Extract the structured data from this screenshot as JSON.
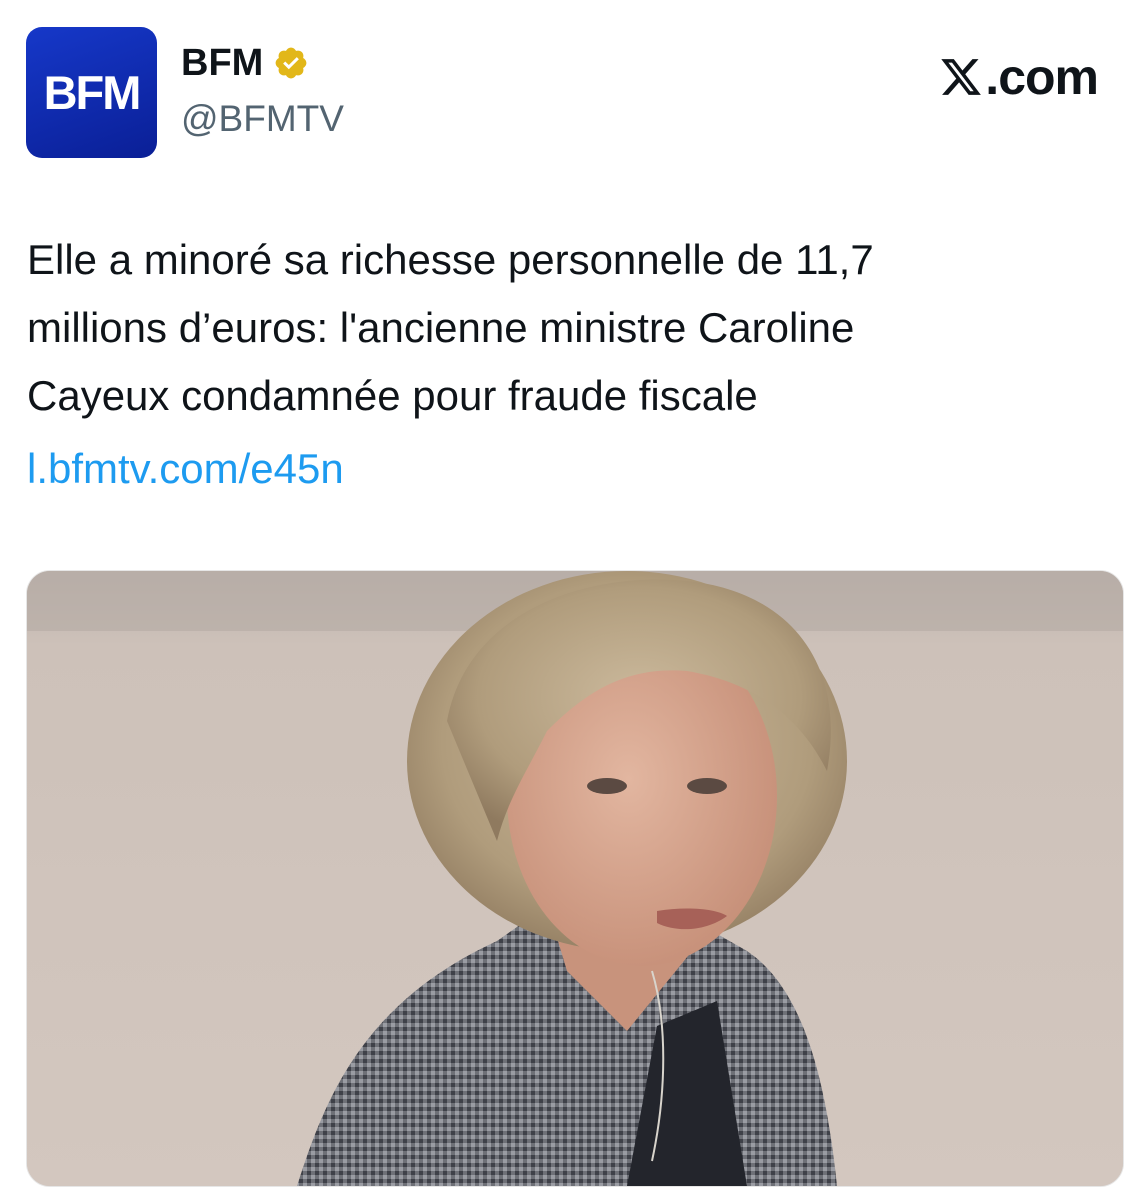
{
  "account": {
    "avatar_text": "BFM",
    "display_name": "BFM",
    "handle": "@BFMTV",
    "verified_icon": "verified-gold-badge-icon",
    "avatar_color": "#1435c4",
    "badge_color": "#e2b719"
  },
  "platform": {
    "label": ".com",
    "logo_icon": "x-logo-icon"
  },
  "tweet": {
    "text": "Elle a minoré sa richesse personnelle de 11,7\nmillions d’euros: l'ancienne ministre Caroline\nCayeux condamnée pour fraude fiscale",
    "link": "l.bfmtv.com/e45n",
    "link_color": "#1d9bf0"
  },
  "media": {
    "photo_icon": "portrait-photo"
  }
}
